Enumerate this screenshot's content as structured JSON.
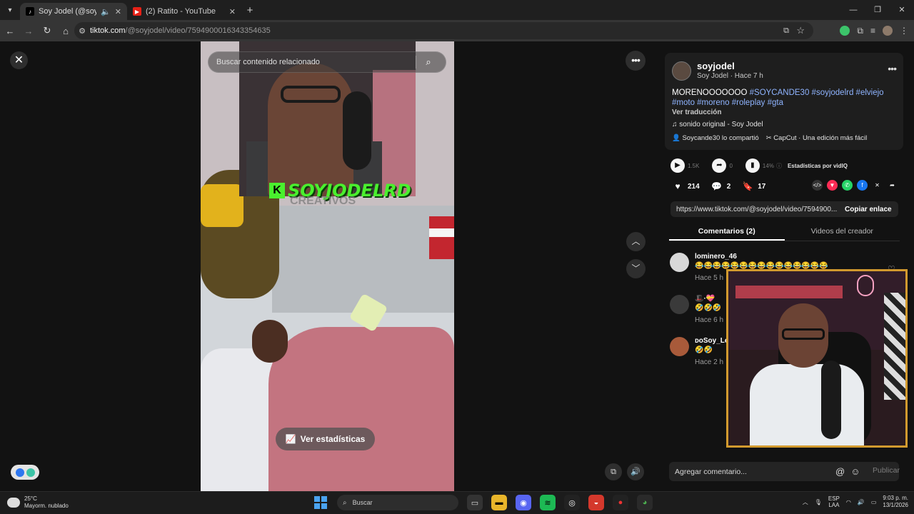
{
  "browser": {
    "tabs": [
      {
        "title": "Soy Jodel (@soyjodel) | Tik",
        "active": true
      },
      {
        "title": "(2) Ratito - YouTube",
        "active": false
      }
    ],
    "url_host": "tiktok.com",
    "url_path": "/@soyjodel/video/7594900016343354635"
  },
  "video": {
    "search_placeholder": "Buscar contenido relacionado",
    "overlay_brand": "SOYJODELRD",
    "overlay_watermark": "CREATIVOS",
    "stats_button": "Ver estadísticas"
  },
  "post": {
    "username": "soyjodel",
    "meta": "Soy Jodel · Hace 7 h",
    "caption_text": "MORENOOOOOOO ",
    "hashtags_line1": "#SOYCANDE30 #soyjodelrd #elviejo",
    "hashtags_line2": "#moto #moreno #roleplay #gta",
    "translate": "Ver traducción",
    "sound": "sonido original - Soy Jodel",
    "shared_by": "Soycande30 lo compartió",
    "capcut": "CapCut · Una edición más fácil"
  },
  "vidiq": {
    "views": "1.5K",
    "shares": "0",
    "percent": "14%",
    "label": "Estadísticas por vidIQ"
  },
  "engagement": {
    "likes": "214",
    "comments": "2",
    "saves": "17"
  },
  "link": {
    "url": "https://www.tiktok.com/@soyjodel/video/7594900...",
    "copy_label": "Copiar enlace"
  },
  "tabs": {
    "comments": "Comentarios (2)",
    "creator_videos": "Videos del creador"
  },
  "comments": [
    {
      "name": "lominero_46",
      "text": "😂😂😂😂😂😂😂😂😂😂😂😂😂😂😂",
      "time": "Hace 5 h"
    },
    {
      "name": "🎩·💝",
      "text": "🤣🤣🤣",
      "time": "Hace 6 h"
    },
    {
      "name": "ᴅᴏSoy_Leo",
      "text": "🤣🤣",
      "time": "Hace 2 h"
    }
  ],
  "comment_box": {
    "placeholder": "Agregar comentario...",
    "publish": "Publicar"
  },
  "taskbar": {
    "temperature": "25°C",
    "weather": "Mayorm. nublado",
    "search": "Buscar",
    "lang1": "ESP",
    "lang2": "LAA",
    "time": "9:03 p. m.",
    "date": "13/1/2026"
  },
  "icons": {
    "tiktok_favicon": "tiktok-icon",
    "youtube_favicon": "youtube-icon",
    "close": "close-icon",
    "search": "search-icon"
  },
  "colors": {
    "accent_green": "#4af02e",
    "hashtag": "#8fb4ff",
    "pip_border": "#d29a2e"
  }
}
